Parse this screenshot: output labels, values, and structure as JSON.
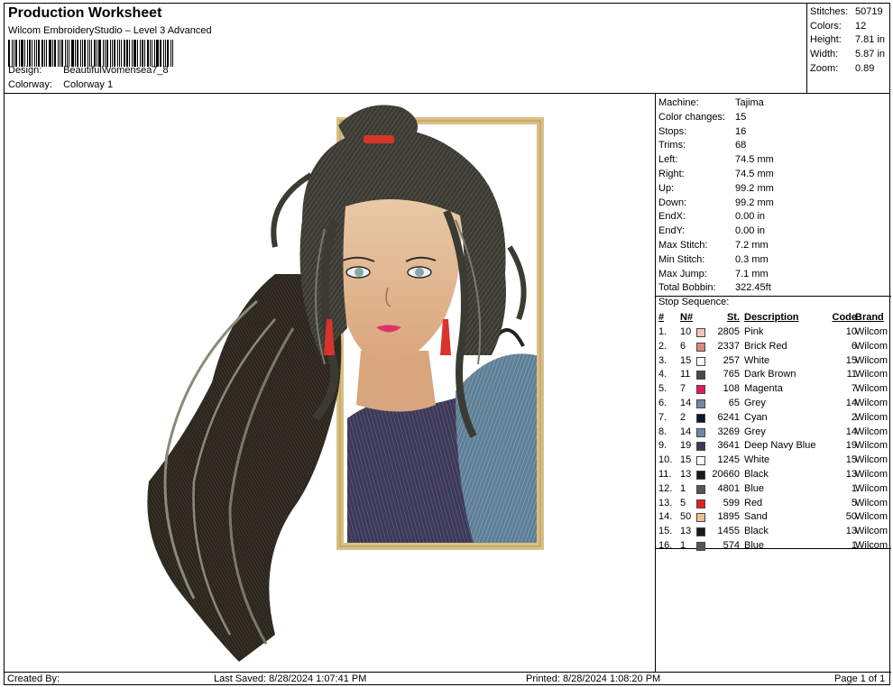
{
  "header": {
    "title": "Production Worksheet",
    "software": "Wilcom EmbroideryStudio – Level 3 Advanced",
    "design_label": "Design:",
    "design_value": "BeautifulWomensea7_8",
    "colorway_label": "Colorway:",
    "colorway_value": "Colorway 1"
  },
  "summary": [
    {
      "k": "Stitches:",
      "v": "50719"
    },
    {
      "k": "Colors:",
      "v": "12"
    },
    {
      "k": "Height:",
      "v": "7.81 in"
    },
    {
      "k": "Width:",
      "v": "5.87 in"
    },
    {
      "k": "Zoom:",
      "v": "0.89"
    }
  ],
  "machine_info": [
    {
      "k": "Machine:",
      "v": "Tajima"
    },
    {
      "k": "Color changes:",
      "v": "15"
    },
    {
      "k": "Stops:",
      "v": "16"
    },
    {
      "k": "Trims:",
      "v": "68"
    },
    {
      "k": "Left:",
      "v": "74.5 mm"
    },
    {
      "k": "Right:",
      "v": "74.5 mm"
    },
    {
      "k": "Up:",
      "v": "99.2 mm"
    },
    {
      "k": "Down:",
      "v": "99.2 mm"
    },
    {
      "k": "EndX:",
      "v": "0.00 in"
    },
    {
      "k": "EndY:",
      "v": "0.00 in"
    },
    {
      "k": "Max Stitch:",
      "v": "7.2 mm"
    },
    {
      "k": "Min Stitch:",
      "v": "0.3 mm"
    },
    {
      "k": "Max Jump:",
      "v": "7.1 mm"
    },
    {
      "k": "Total Bobbin:",
      "v": "322.45ft"
    }
  ],
  "stop_sequence": {
    "title": "Stop Sequence:",
    "headers": {
      "num": "#",
      "n": "N#",
      "st": "St.",
      "desc": "Description",
      "code": "Code",
      "brand": "Brand"
    },
    "rows": [
      {
        "num": "1.",
        "n": "10",
        "color": "#f2c4b4",
        "st": "2805",
        "desc": "Pink",
        "code": "10",
        "brand": "Wilcom"
      },
      {
        "num": "2.",
        "n": "6",
        "color": "#d98b73",
        "st": "2337",
        "desc": "Brick Red",
        "code": "6",
        "brand": "Wilcom"
      },
      {
        "num": "3.",
        "n": "15",
        "color": "#ffffff",
        "st": "257",
        "desc": "White",
        "code": "15",
        "brand": "Wilcom"
      },
      {
        "num": "4.",
        "n": "11",
        "color": "#4a4a4a",
        "st": "765",
        "desc": "Dark Brown",
        "code": "11",
        "brand": "Wilcom"
      },
      {
        "num": "5.",
        "n": "7",
        "color": "#e8175d",
        "st": "108",
        "desc": "Magenta",
        "code": "7",
        "brand": "Wilcom"
      },
      {
        "num": "6.",
        "n": "14",
        "color": "#6f87a8",
        "st": "65",
        "desc": "Grey",
        "code": "14",
        "brand": "Wilcom"
      },
      {
        "num": "7.",
        "n": "2",
        "color": "#0a1830",
        "st": "6241",
        "desc": "Cyan",
        "code": "2",
        "brand": "Wilcom"
      },
      {
        "num": "8.",
        "n": "14",
        "color": "#6f87a8",
        "st": "3269",
        "desc": "Grey",
        "code": "14",
        "brand": "Wilcom"
      },
      {
        "num": "9.",
        "n": "19",
        "color": "#3a3a5c",
        "st": "3641",
        "desc": "Deep Navy Blue",
        "code": "19",
        "brand": "Wilcom"
      },
      {
        "num": "10.",
        "n": "15",
        "color": "#ffffff",
        "st": "1245",
        "desc": "White",
        "code": "15",
        "brand": "Wilcom"
      },
      {
        "num": "11.",
        "n": "13",
        "color": "#1a1a1a",
        "st": "20660",
        "desc": "Black",
        "code": "13",
        "brand": "Wilcom"
      },
      {
        "num": "12.",
        "n": "1",
        "color": "#555555",
        "st": "4801",
        "desc": "Blue",
        "code": "1",
        "brand": "Wilcom"
      },
      {
        "num": "13.",
        "n": "5",
        "color": "#e02020",
        "st": "599",
        "desc": "Red",
        "code": "5",
        "brand": "Wilcom"
      },
      {
        "num": "14.",
        "n": "50",
        "color": "#f0c090",
        "st": "1895",
        "desc": "Sand",
        "code": "50",
        "brand": "Wilcom"
      },
      {
        "num": "15.",
        "n": "13",
        "color": "#1a1a1a",
        "st": "1455",
        "desc": "Black",
        "code": "13",
        "brand": "Wilcom"
      },
      {
        "num": "16.",
        "n": "1",
        "color": "#555555",
        "st": "574",
        "desc": "Blue",
        "code": "1",
        "brand": "Wilcom"
      }
    ]
  },
  "footer": {
    "created_by": "Created By:",
    "last_saved": "Last Saved: 8/28/2024 1:07:41 PM",
    "printed": "Printed: 8/28/2024 1:08:20 PM",
    "page": "Page 1 of 1"
  }
}
